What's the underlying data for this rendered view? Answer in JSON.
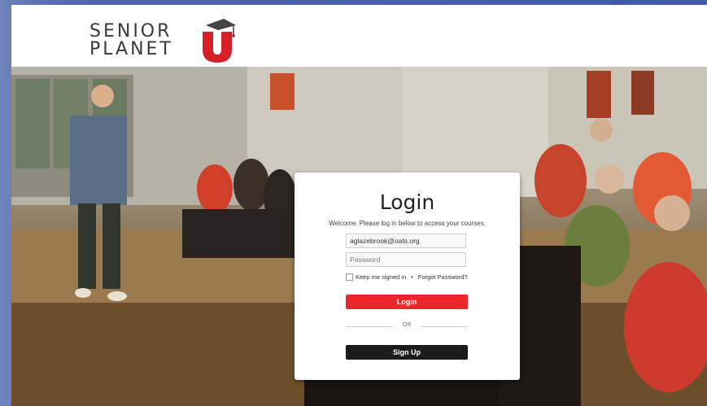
{
  "brand": {
    "line1": "SENIOR",
    "line2": "PLANET",
    "mark": "U",
    "accent_color": "#d62027"
  },
  "login": {
    "title": "Login",
    "welcome": "Welcome. Please log in below to access your courses.",
    "email_value": "aglazebrook@oats.org",
    "password_placeholder": "Password",
    "remember_label": "Keep me signed in",
    "separator": "•",
    "forgot_label": "Forgot Password?",
    "login_button": "Login",
    "or_label": "OR",
    "signup_button": "Sign Up"
  }
}
